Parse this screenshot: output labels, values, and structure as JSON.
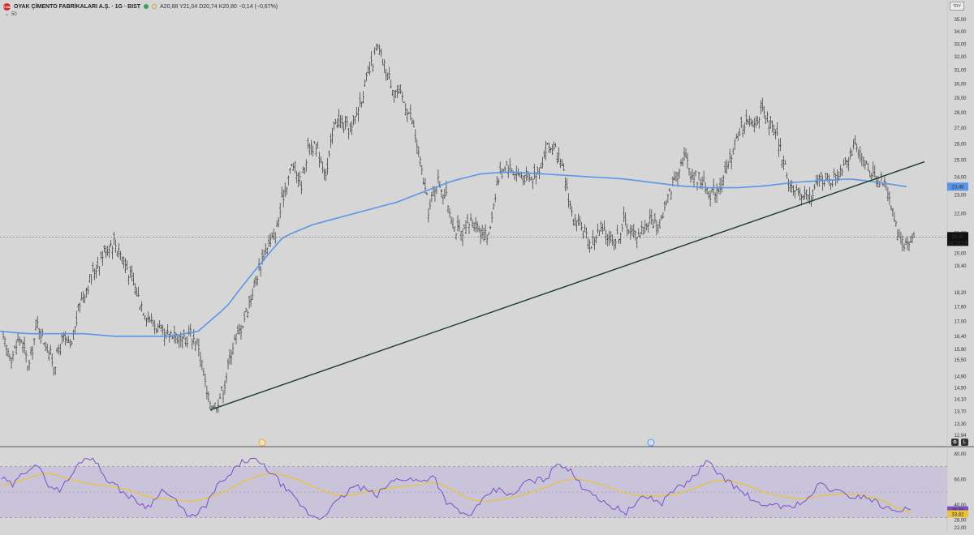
{
  "header": {
    "logo_text": "OYAK",
    "title": "OYAK ÇİMENTO FABRİKALARI A.Ş. · 1G · BIST",
    "ohlc": "A20,88 Y21,04 D20,74 K20,80 −0,14 (−0,67%)",
    "ma_label": "50",
    "currency": "TRY"
  },
  "colors": {
    "background": "#d6d6d6",
    "ma_line": "#5a96e8",
    "trendline": "#1d3d2a",
    "rsi_line": "#7a4fc7",
    "rsi_ma": "#ebc33a",
    "rsi_band": "#c9c4da",
    "price_bar": "#333333"
  },
  "price_axis": {
    "ticks": [
      "35,00",
      "34,00",
      "33,00",
      "32,00",
      "31,00",
      "30,00",
      "29,00",
      "28,00",
      "27,00",
      "26,00",
      "25,00",
      "24,00",
      "23,00",
      "22,00",
      "21,00",
      "20,00",
      "19,40",
      "18,20",
      "17,60",
      "17,00",
      "16,40",
      "15,90",
      "15,50",
      "14,90",
      "14,50",
      "14,10",
      "13,70",
      "13,30",
      "12,94"
    ],
    "last_price": "20,80",
    "countdown": "04:18:14",
    "ma_value": "23,46"
  },
  "rsi_axis": {
    "ticks": [
      "80,00",
      "60,00",
      "40,00",
      "28,00",
      "22,00"
    ],
    "rsi_value": "35,60",
    "rsi_ma_value": "33,82"
  },
  "chart_data": [
    {
      "type": "line",
      "title": "",
      "ylim": [
        12.94,
        35.0
      ],
      "log_scale": true,
      "grid": false,
      "series": [
        {
          "name": "",
          "style": "ohlc-bars",
          "values": [
            16.2,
            15.6,
            16.4,
            15.2,
            16.9,
            16.1,
            15.3,
            16.3,
            15.9,
            17.8,
            18.6,
            19.4,
            20.2,
            20.6,
            19.8,
            18.9,
            17.9,
            17.2,
            16.8,
            16.3,
            16.6,
            16.1,
            16.5,
            16.0,
            14.1,
            13.9,
            14.6,
            16.1,
            16.8,
            17.9,
            19.2,
            20.4,
            20.9,
            23.2,
            24.8,
            23.6,
            26.1,
            25.4,
            24.2,
            27.6,
            27.1,
            26.9,
            28.9,
            30.8,
            32.6,
            30.9,
            29.6,
            28.9,
            27.6,
            24.8,
            22.1,
            23.9,
            22.9,
            21.3,
            20.8,
            21.7,
            21.2,
            20.7,
            23.7,
            24.8,
            24.3,
            24.1,
            23.9,
            24.6,
            25.9,
            25.4,
            23.9,
            21.6,
            21.2,
            20.4,
            21.1,
            20.9,
            20.6,
            21.6,
            20.9,
            21.1,
            21.7,
            21.3,
            22.6,
            24.2,
            25.3,
            24.1,
            23.9,
            23.1,
            23.4,
            24.3,
            26.1,
            27.4,
            27.1,
            28.1,
            27.3,
            26.2,
            24.3,
            22.9,
            23.2,
            22.8,
            24.1,
            23.7,
            24.1,
            25.1,
            25.8,
            24.9,
            24.3,
            23.9,
            23.2,
            21.1,
            20.4,
            20.8
          ]
        },
        {
          "name": "",
          "style": "moving-average",
          "values": [
            16.6,
            16.5,
            16.5,
            16.5,
            16.4,
            16.4,
            16.4,
            16.6,
            17.6,
            19.2,
            20.8,
            21.4,
            21.8,
            22.2,
            22.6,
            23.2,
            23.8,
            24.2,
            24.3,
            24.2,
            24.1,
            24.0,
            23.9,
            23.7,
            23.5,
            23.4,
            23.4,
            23.5,
            23.7,
            23.8,
            23.9,
            23.7,
            23.46
          ]
        },
        {
          "name": "",
          "style": "trendline",
          "values": [
            13.75,
            24.9
          ]
        }
      ]
    },
    {
      "type": "line",
      "title": "",
      "ylim": [
        22.0,
        80.0
      ],
      "grid": false,
      "band": [
        30,
        70
      ],
      "series": [
        {
          "name": "",
          "values": [
            61,
            55,
            66,
            73,
            57,
            51,
            61,
            75,
            78,
            63,
            55,
            48,
            42,
            38,
            52,
            46,
            35,
            30,
            40,
            55,
            62,
            73,
            76,
            71,
            63,
            52,
            43,
            33,
            29,
            38,
            46,
            55,
            52,
            47,
            56,
            61,
            60,
            58,
            64,
            44,
            36,
            31,
            39,
            50,
            52,
            46,
            58,
            59,
            61,
            74,
            67,
            55,
            50,
            41,
            38,
            34,
            43,
            47,
            40,
            52,
            55,
            63,
            74,
            66,
            58,
            51,
            45,
            37,
            42,
            37,
            41,
            44,
            57,
            52,
            49,
            46,
            47,
            42,
            36.6,
            37,
            35.6
          ]
        },
        {
          "name": "",
          "values": [
            55,
            57,
            60,
            63,
            65,
            63,
            60,
            58,
            56,
            55,
            54,
            52,
            49,
            46,
            45,
            44,
            43,
            43,
            45,
            48,
            52,
            57,
            61,
            64,
            65,
            63,
            60,
            56,
            52,
            49,
            47,
            48,
            50,
            51,
            53,
            54,
            55,
            56,
            58,
            55,
            50,
            45,
            43,
            43,
            44,
            46,
            48,
            51,
            54,
            58,
            60,
            60,
            58,
            55,
            52,
            49,
            47,
            47,
            47,
            48,
            50,
            53,
            57,
            59,
            59,
            57,
            54,
            50,
            48,
            46,
            45,
            45,
            47,
            48,
            49,
            48,
            47,
            45,
            41,
            37,
            33.8
          ]
        }
      ]
    }
  ]
}
